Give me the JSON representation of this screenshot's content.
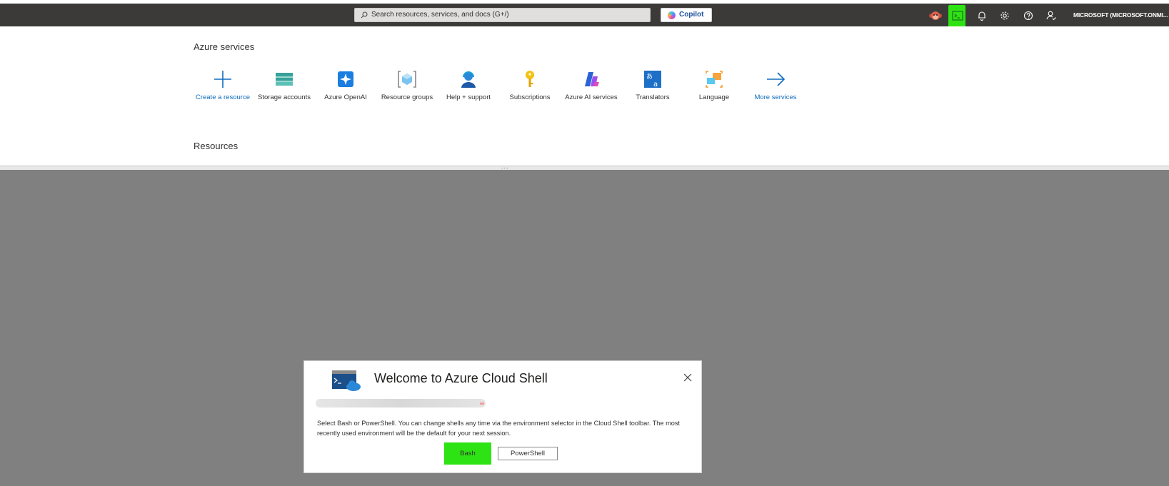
{
  "topbar": {
    "search_placeholder": "Search resources, services, and docs (G+/)",
    "copilot_label": "Copilot",
    "icons": [
      "monkey-avatar-icon",
      "cloud-shell-icon",
      "bell-icon",
      "gear-icon",
      "help-icon",
      "feedback-icon"
    ],
    "account_label": "MICROSOFT (MICROSOFT.ONMI..."
  },
  "azure_services": {
    "title": "Azure services",
    "items": [
      {
        "label": "Create a resource",
        "icon": "plus-icon"
      },
      {
        "label": "Storage accounts",
        "icon": "storage-icon"
      },
      {
        "label": "Azure OpenAI",
        "icon": "openai-icon"
      },
      {
        "label": "Resource groups",
        "icon": "resource-group-icon"
      },
      {
        "label": "Help + support",
        "icon": "support-icon"
      },
      {
        "label": "Subscriptions",
        "icon": "key-icon"
      },
      {
        "label": "Azure AI services",
        "icon": "ai-services-icon"
      },
      {
        "label": "Translators",
        "icon": "translator-icon"
      },
      {
        "label": "Language",
        "icon": "language-icon"
      },
      {
        "label": "More services",
        "icon": "arrow-right-icon"
      }
    ]
  },
  "resources": {
    "title": "Resources"
  },
  "handle": {
    "dots": "..."
  },
  "dialog": {
    "title": "Welcome to Azure Cloud Shell",
    "description": "Select Bash or PowerShell. You can change shells any time via the environment selector in the Cloud Shell toolbar. The most recently used environment will be the default for your next session.",
    "bash_label": "Bash",
    "powershell_label": "PowerShell"
  },
  "colors": {
    "accent": "#0f6cbd",
    "highlight": "#2ee313",
    "annotation": "#e8161b",
    "overlay": "#808080",
    "topbar": "#3b3a39"
  }
}
